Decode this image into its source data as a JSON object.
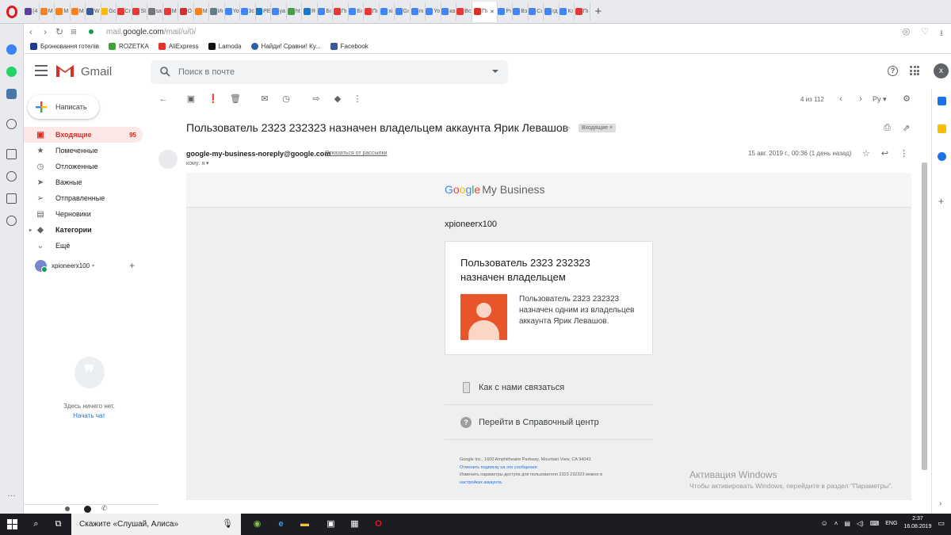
{
  "browser": {
    "tabs": [
      "(4",
      "M",
      "M",
      "M",
      "W",
      "Gc",
      "Cr",
      "SI",
      "sa",
      "M",
      "O",
      "M",
      "Иı",
      "Yo",
      "3c",
      "PE",
      "ya",
      "ht",
      "Я",
      "Бı",
      "Пı",
      "Бı",
      "Пı",
      "xi",
      "Gı",
      "пı",
      "Yo",
      "ка",
      "Вс",
      "Пı",
      "Pı",
      "Вз",
      "Сı",
      "гд",
      "Kı",
      "Пı"
    ],
    "active_tab_label": "Пı",
    "url_prefix": "mail.",
    "url_domain": "google.com",
    "url_path": "/mail/u/0/",
    "bookmarks": [
      "Бронювання готелів",
      "ROZETKA",
      "AliExpress",
      "Lamoda",
      "Найди! Сравни! Ку...",
      "Facebook"
    ]
  },
  "gmail": {
    "brand": "Gmail",
    "search_placeholder": "Поиск в почте",
    "account_initial": "x",
    "compose_label": "Написать",
    "nav": [
      {
        "label": "Входящие",
        "count": "95"
      },
      {
        "label": "Помеченные"
      },
      {
        "label": "Отложенные"
      },
      {
        "label": "Важные"
      },
      {
        "label": "Отправленные"
      },
      {
        "label": "Черновики"
      },
      {
        "label": "Категории"
      },
      {
        "label": "Ещё"
      }
    ],
    "hangouts_user": "xpioneerx100",
    "hangouts_empty": "Здесь ничего нет.",
    "hangouts_start_chat": "Начать чат",
    "pager": "4 из 112",
    "input_lang": "Ру"
  },
  "message": {
    "subject": "Пользователь 2323 232323 назначен владельцем аккаунта Ярик Левашов",
    "label_chip": "Входящие",
    "sender": "google-my-business-noreply@google.com",
    "unsubscribe": "Отказаться от рассылки",
    "to_me": "кому: я",
    "date": "15 авг. 2019 г., 00:36 (1 день назад)"
  },
  "email_body": {
    "logo_parts": [
      "G",
      "o",
      "o",
      "g",
      "l",
      "e"
    ],
    "logo_product": "My Business",
    "account_name": "xpioneerx100",
    "card_title": "Пользователь 2323 232323 назначен владельцем",
    "card_text": "Пользователь 2323 232323 назначен одним из владельцев аккаунта Ярик Левашов.",
    "contact_link": "Как с нами связаться",
    "help_link": "Перейти в Справочный центр",
    "footer_address": "Google Inc., 1600 Amphitheatre Parkway, Mountain View, CA 94043",
    "footer_unsubscribe": "Отменить подписку на эти сообщения.",
    "footer_settings": "Изменить параметры доступа для пользователя 2323 232323 можно в",
    "footer_settings_link": "настройках аккаунта."
  },
  "windows": {
    "activate_title": "Активация Windows",
    "activate_sub": "Чтобы активировать Windows, перейдите в раздел \"Параметры\".",
    "taskbar_search": "Скажите «Слушай, Алиса»",
    "lang": "ENG",
    "time": "2:37",
    "date": "16.08.2019"
  },
  "colors": {
    "gmail_red": "#d93025",
    "gmb_orange": "#e8552b",
    "active_nav_bg": "#fce8e6"
  }
}
